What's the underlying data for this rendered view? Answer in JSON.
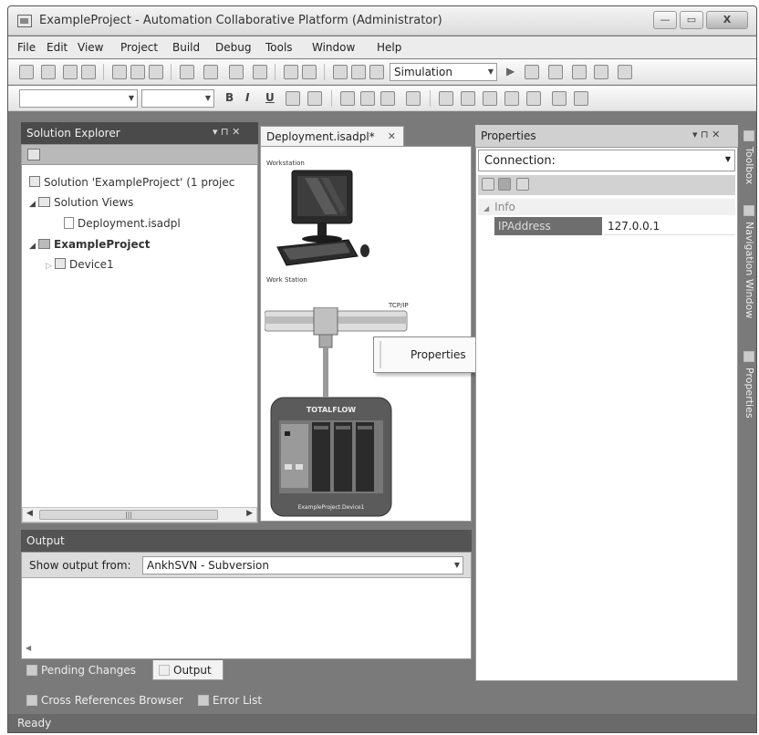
{
  "window": {
    "title": "ExampleProject - Automation Collaborative Platform (Administrator)",
    "buttons": {
      "minimize": "—",
      "maximize": "▭",
      "close": "X"
    }
  },
  "menu": [
    "File",
    "Edit",
    "View",
    "Project",
    "Build",
    "Debug",
    "Tools",
    "Window",
    "Help"
  ],
  "toolbar": {
    "config_select": "Simulation",
    "format": {
      "bold": "B",
      "italic": "I",
      "underline": "U"
    }
  },
  "solution_explorer": {
    "title": "Solution Explorer",
    "controls": {
      "pin": "▾ ⊓ ✕"
    },
    "items": [
      {
        "label": "Solution 'ExampleProject' (1 projec"
      },
      {
        "label": "Solution Views"
      },
      {
        "label": "Deployment.isadpl"
      },
      {
        "label": "ExampleProject"
      },
      {
        "label": "Device1"
      }
    ],
    "scroll_thumb": "|||"
  },
  "document": {
    "tab_label": "Deployment.isadpl*",
    "tab_close": "✕",
    "workstation_top_label": "Workstation",
    "workstation_label": "Work Station",
    "network_label": "TCP/IP",
    "device_header": "TOTALFLOW",
    "device_label": "ExampleProject.Device1"
  },
  "context_menu": {
    "items": [
      "Properties"
    ]
  },
  "properties": {
    "title": "Properties",
    "controls": "▾ ⊓ ✕",
    "selector": "Connection:",
    "category": "Info",
    "rows": [
      {
        "name": "IPAddress",
        "value": "127.0.0.1"
      }
    ]
  },
  "right_tabs": [
    "Toolbox",
    "Navigation Window",
    "Properties"
  ],
  "output": {
    "title": "Output",
    "show_label": "Show output from:",
    "source": "AnkhSVN - Subversion"
  },
  "bottom_tabs": [
    "Pending Changes",
    "Output"
  ],
  "bottom_tabs2": [
    "Cross References Browser",
    "Error List"
  ],
  "status": {
    "text": "Ready"
  }
}
